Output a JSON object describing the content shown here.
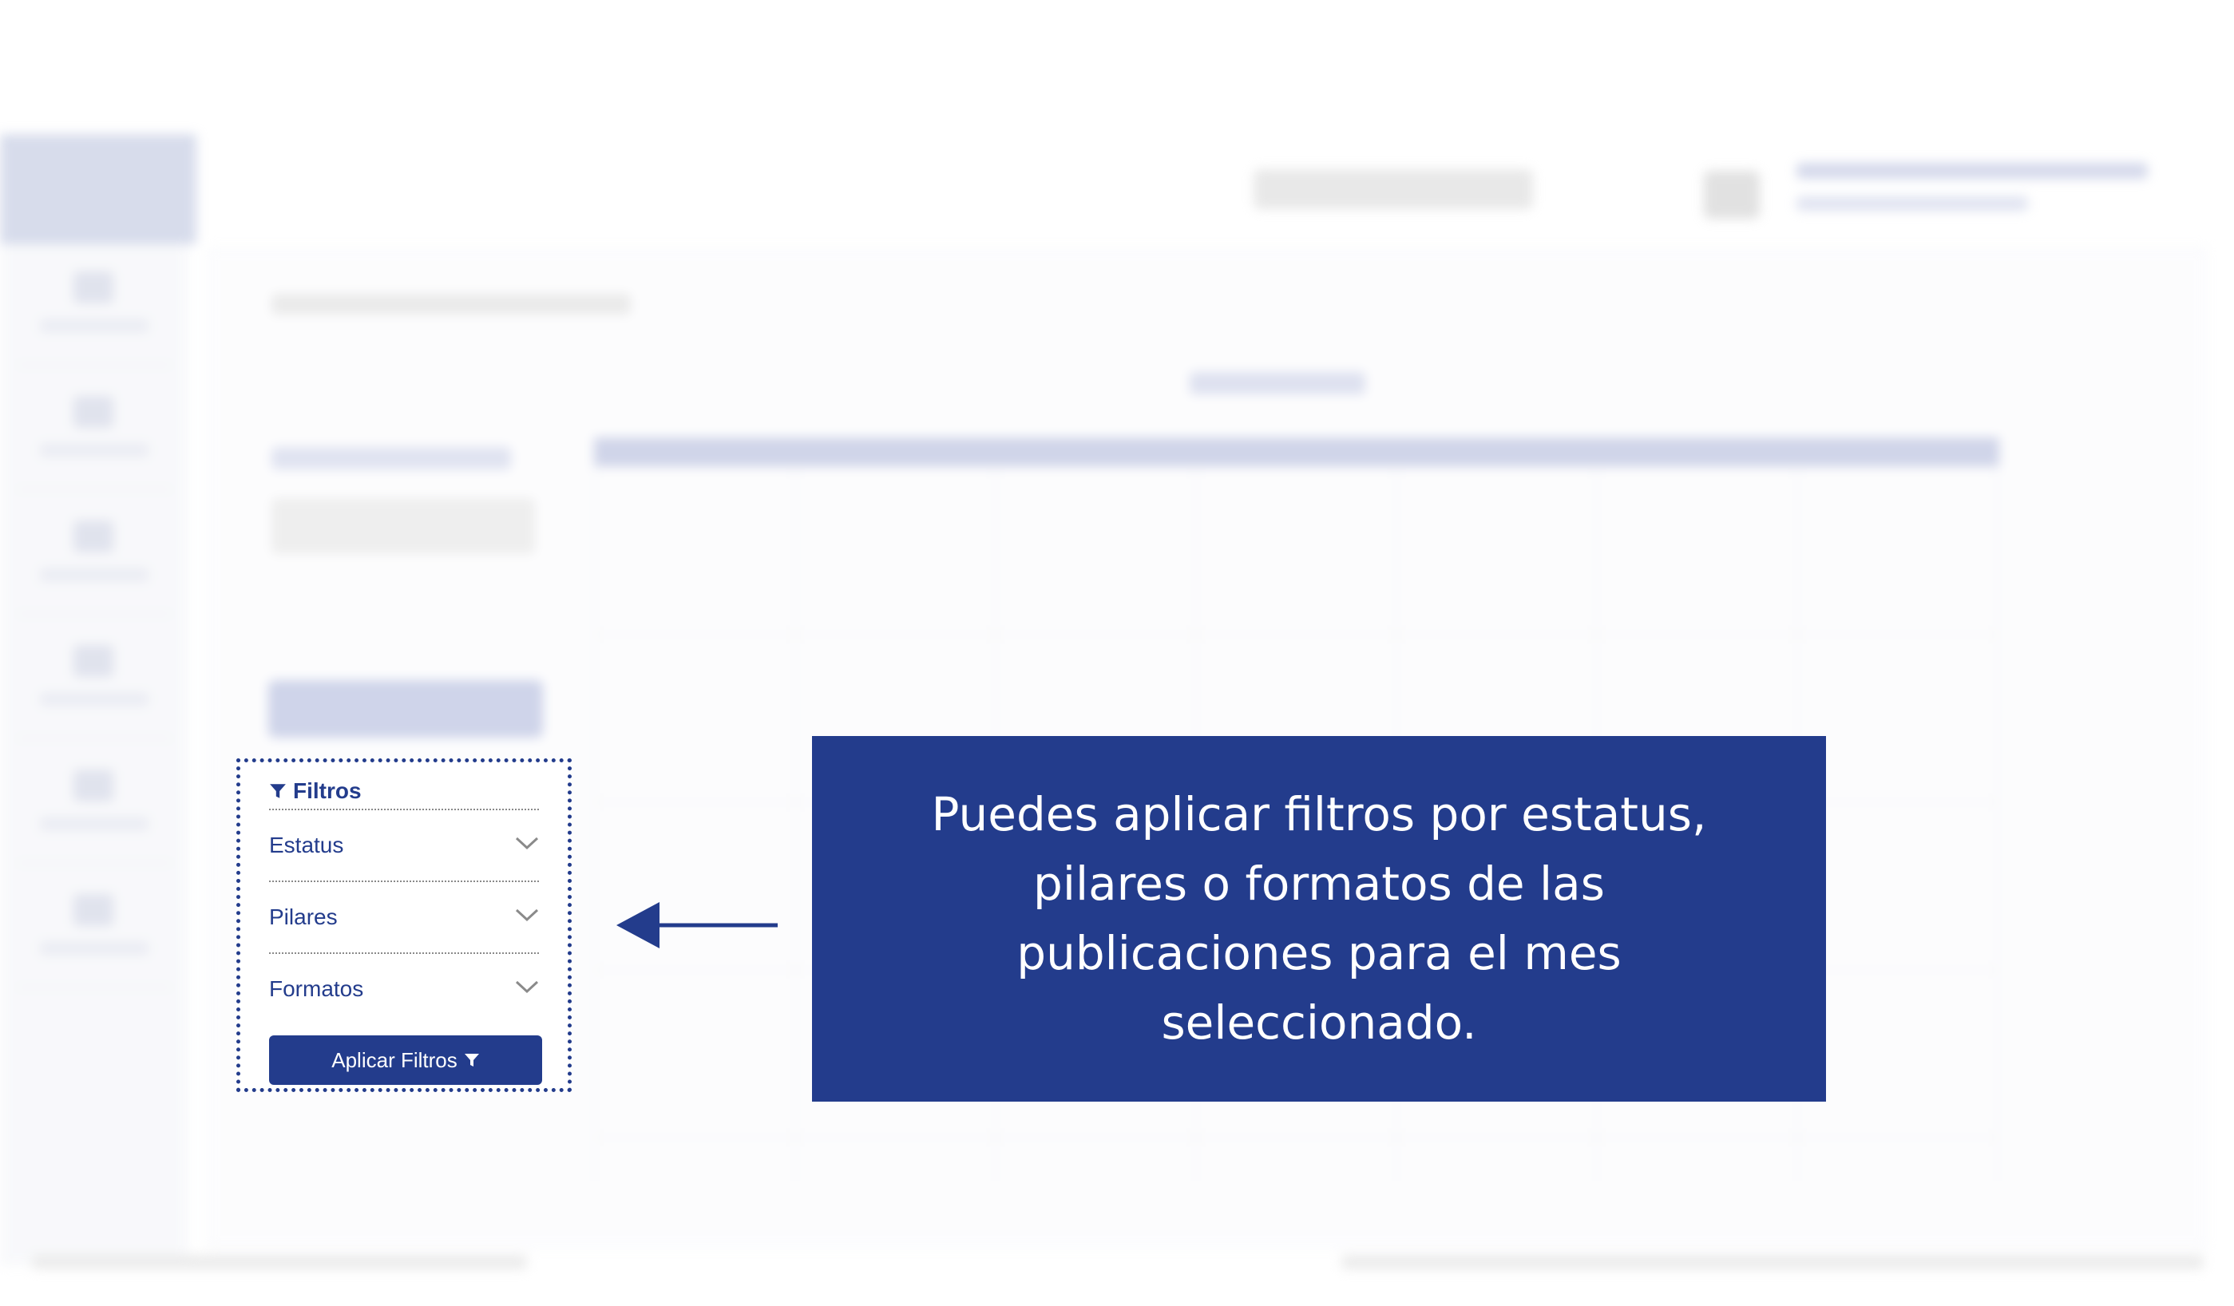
{
  "filters": {
    "title": "Filtros",
    "items": [
      {
        "label": "Estatus"
      },
      {
        "label": "Pilares"
      },
      {
        "label": "Formatos"
      }
    ],
    "apply_label": "Aplicar Filtros"
  },
  "callout": {
    "text": "Puedes aplicar filtros por estatus, pilares o formatos de las publicaciones para el mes seleccionado."
  },
  "colors": {
    "accent": "#233c8c",
    "background": "#ffffff"
  },
  "icons": {
    "filter": "funnel-icon",
    "dropdown": "chevron-down-icon",
    "pointer": "arrow-left-icon"
  }
}
